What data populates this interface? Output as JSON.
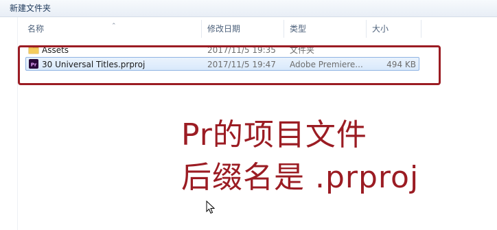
{
  "toolbar": {
    "new_folder_label": "新建文件夹"
  },
  "columns": {
    "name": "名称",
    "modified": "修改日期",
    "type": "类型",
    "size": "大小"
  },
  "files": [
    {
      "name": "Assets",
      "modified": "2017/11/5 19:35",
      "type": "文件夹",
      "size": "",
      "icon": "folder-icon"
    },
    {
      "name": "30 Universal Titles.prproj",
      "modified": "2017/11/5 19:47",
      "type": "Adobe Premiere...",
      "size": "494 KB",
      "icon": "premiere-pro-file-icon",
      "selected": true
    }
  ],
  "annotation": {
    "line1": "Pr的项目文件",
    "line2": "后缀名是 .prproj",
    "color": "#9b1c23"
  },
  "icons": {
    "sort": "sort-up-icon",
    "cursor": "mouse-pointer-icon"
  }
}
